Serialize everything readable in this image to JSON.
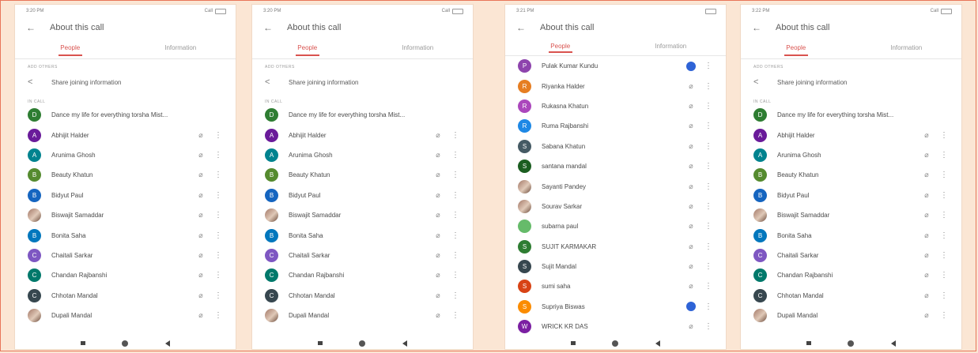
{
  "colors": {
    "background": "#fbe6d4",
    "frame_border": "#e8765a",
    "accent_tab": "#d9534f",
    "speaking_indicator": "#2e63d6"
  },
  "screens": [
    {
      "status_time": "3:20 PM",
      "status_network": "Call",
      "title": "About this call",
      "tab_people": "People",
      "tab_information": "Information",
      "add_others_label": "ADD OTHERS",
      "share_text": "Share joining information",
      "in_call_label": "IN CALL",
      "participants": [
        {
          "initial": "D",
          "color": "#2e7d32",
          "name": "Dance my life for everything torsha Mist..."
        },
        {
          "initial": "A",
          "color": "#6a1b9a",
          "name": "Abhijit Halder"
        },
        {
          "initial": "A",
          "color": "#00838f",
          "name": "Arunima Ghosh"
        },
        {
          "initial": "B",
          "color": "#558b2f",
          "name": "Beauty Khatun"
        },
        {
          "initial": "B",
          "color": "#1565c0",
          "name": "Bidyut Paul"
        },
        {
          "initial": "",
          "color": "photo",
          "name": "Biswajit Samaddar"
        },
        {
          "initial": "B",
          "color": "#0277bd",
          "name": "Bonita Saha"
        },
        {
          "initial": "C",
          "color": "#7e57c2",
          "name": "Chaitali Sarkar"
        },
        {
          "initial": "C",
          "color": "#00796b",
          "name": "Chandan Rajbanshi"
        },
        {
          "initial": "C",
          "color": "#37474f",
          "name": "Chhotan Mandal"
        },
        {
          "initial": "",
          "color": "photo",
          "name": "Dupali Mandal"
        }
      ]
    },
    {
      "status_time": "3:20 PM",
      "status_network": "Call",
      "title": "About this call",
      "tab_people": "People",
      "tab_information": "Information",
      "add_others_label": "ADD OTHERS",
      "share_text": "Share joining information",
      "in_call_label": "IN CALL",
      "participants": [
        {
          "initial": "D",
          "color": "#2e7d32",
          "name": "Dance my life for everything torsha Mist..."
        },
        {
          "initial": "A",
          "color": "#6a1b9a",
          "name": "Abhijit Halder"
        },
        {
          "initial": "A",
          "color": "#00838f",
          "name": "Arunima Ghosh"
        },
        {
          "initial": "B",
          "color": "#558b2f",
          "name": "Beauty Khatun"
        },
        {
          "initial": "B",
          "color": "#1565c0",
          "name": "Bidyut Paul"
        },
        {
          "initial": "",
          "color": "photo",
          "name": "Biswajit Samaddar"
        },
        {
          "initial": "B",
          "color": "#0277bd",
          "name": "Bonita Saha"
        },
        {
          "initial": "C",
          "color": "#7e57c2",
          "name": "Chaitali Sarkar"
        },
        {
          "initial": "C",
          "color": "#00796b",
          "name": "Chandan Rajbanshi"
        },
        {
          "initial": "C",
          "color": "#37474f",
          "name": "Chhotan Mandal"
        },
        {
          "initial": "",
          "color": "photo",
          "name": "Dupali Mandal"
        }
      ]
    },
    {
      "status_time": "3:21 PM",
      "status_network": "",
      "title": "About this call",
      "tab_people": "People",
      "tab_information": "Information",
      "participants": [
        {
          "initial": "P",
          "color": "#8e44ad",
          "name": "Pulak Kumar Kundu",
          "speaking": true
        },
        {
          "initial": "R",
          "color": "#e67e22",
          "name": "Riyanka Halder"
        },
        {
          "initial": "R",
          "color": "#ab47bc",
          "name": "Rukasna Khatun"
        },
        {
          "initial": "R",
          "color": "#1e88e5",
          "name": "Ruma Rajbanshi"
        },
        {
          "initial": "S",
          "color": "#455a64",
          "name": "Sabana Khatun"
        },
        {
          "initial": "S",
          "color": "#1b5e20",
          "name": "santana mandal"
        },
        {
          "initial": "",
          "color": "photo",
          "name": "Sayanti Pandey"
        },
        {
          "initial": "",
          "color": "photo",
          "name": "Sourav Sarkar"
        },
        {
          "initial": "",
          "color": "#66bb6a",
          "name": "subarna paul"
        },
        {
          "initial": "S",
          "color": "#2e7d32",
          "name": "SUJIT KARMAKAR"
        },
        {
          "initial": "S",
          "color": "#37474f",
          "name": "Sujit Mandal"
        },
        {
          "initial": "S",
          "color": "#d84315",
          "name": "sumi saha"
        },
        {
          "initial": "S",
          "color": "#fb8c00",
          "name": "Supriya Biswas",
          "speaking": true
        },
        {
          "initial": "W",
          "color": "#7b1fa2",
          "name": "WRICK KR DAS"
        }
      ]
    },
    {
      "status_time": "3:22 PM",
      "status_network": "Call",
      "title": "About this call",
      "tab_people": "People",
      "tab_information": "Information",
      "add_others_label": "ADD OTHERS",
      "share_text": "Share joining information",
      "in_call_label": "IN CALL",
      "participants": [
        {
          "initial": "D",
          "color": "#2e7d32",
          "name": "Dance my life for everything torsha Mist..."
        },
        {
          "initial": "A",
          "color": "#6a1b9a",
          "name": "Abhijit Halder"
        },
        {
          "initial": "A",
          "color": "#00838f",
          "name": "Arunima Ghosh"
        },
        {
          "initial": "B",
          "color": "#558b2f",
          "name": "Beauty Khatun"
        },
        {
          "initial": "B",
          "color": "#1565c0",
          "name": "Bidyut Paul"
        },
        {
          "initial": "",
          "color": "photo",
          "name": "Biswajit Samaddar"
        },
        {
          "initial": "B",
          "color": "#0277bd",
          "name": "Bonita Saha"
        },
        {
          "initial": "C",
          "color": "#7e57c2",
          "name": "Chaitali Sarkar"
        },
        {
          "initial": "C",
          "color": "#00796b",
          "name": "Chandan Rajbanshi"
        },
        {
          "initial": "C",
          "color": "#37474f",
          "name": "Chhotan Mandal"
        },
        {
          "initial": "",
          "color": "photo",
          "name": "Dupali Mandal"
        }
      ]
    }
  ]
}
